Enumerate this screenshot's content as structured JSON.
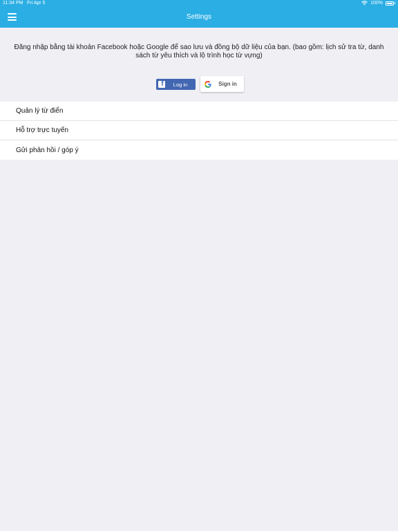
{
  "status_bar": {
    "time": "11:34 PM",
    "date": "Fri Apr 5",
    "battery": "100%"
  },
  "header": {
    "title": "Settings"
  },
  "intro_text": "Đăng nhập bằng tài khoản Facebook hoặc Google để sao lưu và đồng bộ dữ liệu của bạn. (bao gồm: lịch sử tra từ, danh sách từ yêu thích và lộ trình học từ vựng)",
  "buttons": {
    "facebook_label": "Log in",
    "google_label": "Sign in"
  },
  "menu_items": [
    {
      "label": "Quản lý từ điển"
    },
    {
      "label": "Hỗ trợ trực tuyến"
    },
    {
      "label": "Gửi phản hồi / góp ý"
    }
  ],
  "colors": {
    "header": "#2aaee4",
    "facebook": "#4267b2",
    "background": "#efeff4"
  }
}
